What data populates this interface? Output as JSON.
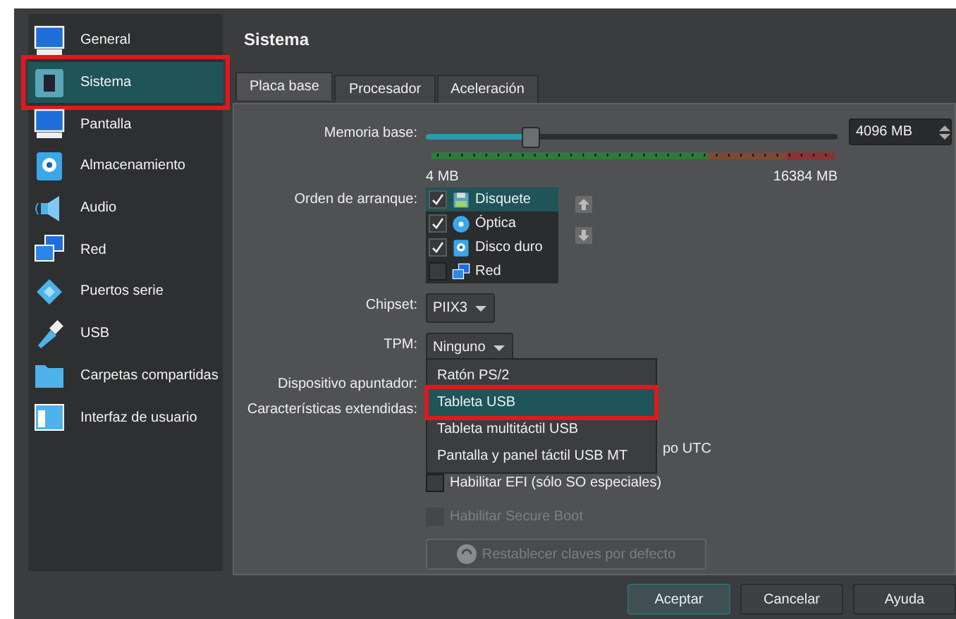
{
  "sidebar": {
    "items": [
      {
        "label": "General",
        "selected": false,
        "highlighted": false
      },
      {
        "label": "Sistema",
        "selected": true,
        "highlighted": true
      },
      {
        "label": "Pantalla",
        "selected": false,
        "highlighted": false
      },
      {
        "label": "Almacenamiento",
        "selected": false,
        "highlighted": false
      },
      {
        "label": "Audio",
        "selected": false,
        "highlighted": false
      },
      {
        "label": "Red",
        "selected": false,
        "highlighted": false
      },
      {
        "label": "Puertos serie",
        "selected": false,
        "highlighted": false
      },
      {
        "label": "USB",
        "selected": false,
        "highlighted": false
      },
      {
        "label": "Carpetas compartidas",
        "selected": false,
        "highlighted": false
      },
      {
        "label": "Interfaz de usuario",
        "selected": false,
        "highlighted": false
      }
    ]
  },
  "page_title": "Sistema",
  "tabs": [
    {
      "label": "Placa base",
      "selected": true
    },
    {
      "label": "Procesador",
      "selected": false
    },
    {
      "label": "Aceleración",
      "selected": false
    }
  ],
  "memory": {
    "label": "Memoria base:",
    "level": 0.25,
    "value": "4096 MB",
    "min_label": "4 MB",
    "max_label": "16384 MB"
  },
  "boot_order": {
    "label": "Orden de arranque:",
    "items": [
      {
        "label": "Disquete",
        "checked": true,
        "selected": true
      },
      {
        "label": "Óptica",
        "checked": true,
        "selected": false
      },
      {
        "label": "Disco duro",
        "checked": true,
        "selected": false
      },
      {
        "label": "Red",
        "checked": false,
        "selected": false
      }
    ]
  },
  "chipset": {
    "label": "Chipset:",
    "value": "PIIX3"
  },
  "tpm": {
    "label": "TPM:",
    "value": "Ninguno"
  },
  "pointing_device": {
    "label": "Dispositivo apuntador:",
    "options": [
      {
        "label": "Ratón PS/2",
        "selected": false,
        "highlighted": false
      },
      {
        "label": "Tableta USB",
        "selected": true,
        "highlighted": true
      },
      {
        "label": "Tableta multitáctil USB",
        "selected": false,
        "highlighted": false
      },
      {
        "label": "Pantalla y panel táctil USB MT",
        "selected": false,
        "highlighted": false
      }
    ]
  },
  "extended_features": {
    "label": "Características extendidas:",
    "options": [
      {
        "label": "po UTC",
        "covered": true
      },
      {
        "label": "Habilitar EFI (sólo SO especiales)",
        "checked": false,
        "disabled": false,
        "covered": false
      },
      {
        "label": "Habilitar Secure Boot",
        "checked": false,
        "disabled": true,
        "covered": false
      }
    ]
  },
  "reset_keys_button": {
    "label": "Restablecer claves por defecto",
    "disabled": true
  },
  "buttons": [
    {
      "label": "Aceptar",
      "default": true
    },
    {
      "label": "Cancelar",
      "default": false
    },
    {
      "label": "Ayuda",
      "default": false
    }
  ]
}
